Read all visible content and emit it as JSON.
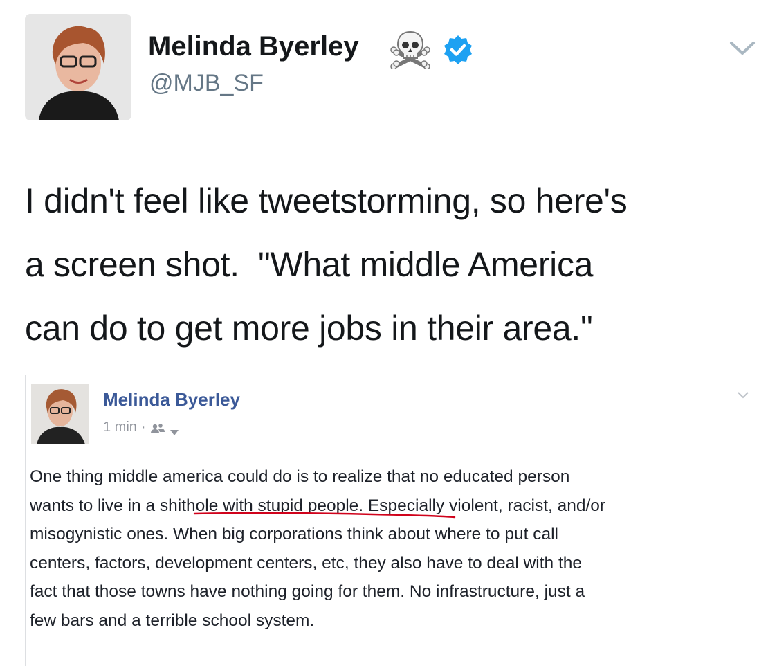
{
  "tweet": {
    "author_name": "Melinda Byerley",
    "author_handle": "@MJB_SF",
    "text_lines": [
      "I didn't feel like tweetstorming, so here's",
      "a screen shot.  \"What middle America",
      "can do to get more jobs in their area.\""
    ],
    "icons": {
      "name_emoji": "skull-and-crossbones-icon",
      "verified": "verified-badge-icon",
      "menu": "chevron-down-icon"
    },
    "colors": {
      "verified_blue": "#1da1f2",
      "handle_gray": "#657786"
    }
  },
  "embedded_post": {
    "author_name": "Melinda Byerley",
    "timestamp": "1 min",
    "separator": "·",
    "body_lines": [
      "One thing middle america could do is to realize that no educated person",
      "wants to live in a shithole with stupid people. Especially violent, racist, and/or",
      "misogynistic ones. When big corporations think about where to put call",
      "centers, factors, development centers, etc, they also have to deal with the",
      "fact that those towns have nothing going for them. No infrastructure, just a",
      "few bars and a terrible school system."
    ],
    "icons": {
      "audience": "friends-audience-icon",
      "audience_menu": "caret-down-icon",
      "post_menu": "chevron-down-icon"
    },
    "colors": {
      "name_blue": "#3b5998",
      "meta_gray": "#90949c",
      "underline_red": "#d0021b"
    }
  }
}
